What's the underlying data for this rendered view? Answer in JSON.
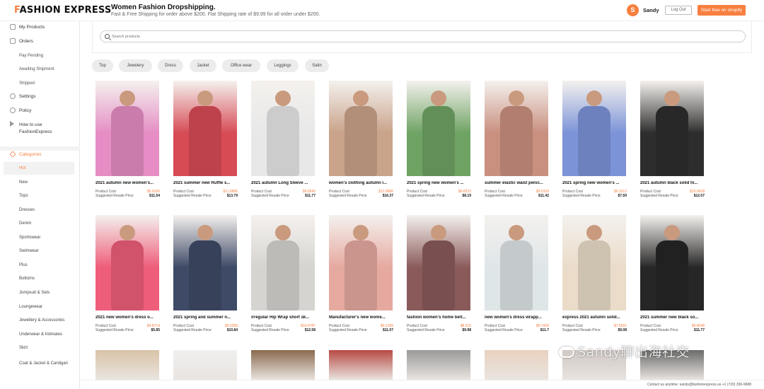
{
  "header": {
    "logo_first": "F",
    "logo_rest": "ASHION EXPRESS",
    "promo_title": "Women Fashion Dropshipping.",
    "promo_sub": "Fast & Free Shipping for order above $200. Flat Shipping rate of $9.99 for all order under $200.",
    "avatar_letter": "S",
    "username": "Sandy",
    "logout_label": "Log Out",
    "start_label": "Start free on shopify",
    "accent_color": "#f77f3f"
  },
  "sidebar": {
    "items": [
      {
        "label": "My Products",
        "icon": "products-icon"
      },
      {
        "label": "Orders",
        "icon": "orders-icon"
      },
      {
        "label": "Settings",
        "icon": "gear-icon"
      },
      {
        "label": "Policy",
        "icon": "shield-icon"
      },
      {
        "label": "How to use FashionExpress",
        "line1": "How to use",
        "line2": "FashionExpress",
        "icon": "play-icon"
      }
    ],
    "order_subs": [
      "Pay Pending",
      "Awaiting Shipment",
      "Shipped"
    ],
    "categories_label": "Categories",
    "categories": [
      "Hot",
      "New",
      "Tops",
      "Dresses",
      "Denim",
      "Sportswear",
      "Swimwear",
      "Plus",
      "Bottoms",
      "Jumpsuit & Sets",
      "Loungewear",
      "Jewellery & Accessories",
      "Underwear & Intimates",
      "Skirt",
      "Coat & Jacket & Cardigan"
    ]
  },
  "search": {
    "placeholder": "Search products"
  },
  "chips": [
    "Top",
    "Jewelery",
    "Dress",
    "Jacket",
    "Office wear",
    "Leggings",
    "Satin"
  ],
  "labels": {
    "product_cost": "Product Cost",
    "resale": "Suggested Resale Price"
  },
  "products": [
    {
      "name": "2021 autumn new women's...",
      "cost": "$5.6326",
      "resale": "$11.54",
      "color": "#e58dc4"
    },
    {
      "name": "2021 summer new Ruffle s...",
      "cost": "$11.6866",
      "resale": "$13.79",
      "color": "#d74b55"
    },
    {
      "name": "2021 autumn Long Sleeve ...",
      "cost": "$9.8540",
      "resale": "$11.77",
      "color": "#e8e8e8"
    },
    {
      "name": "women's clothing autumn l...",
      "cost": "$13.9686",
      "resale": "$16.37",
      "color": "#c9a38a"
    },
    {
      "name": "2021 spring new women's ...",
      "cost": "$6.8232",
      "resale": "$8.19",
      "color": "#6fa363"
    },
    {
      "name": "summer elastic waist penci...",
      "cost": "$9.5109",
      "resale": "$11.42",
      "color": "#c98f7f"
    },
    {
      "name": "2021 spring new women's ...",
      "cost": "$6.3212",
      "resale": "$7.59",
      "color": "#7c93d8"
    },
    {
      "name": "2021 autumn black solid hi...",
      "cost": "$10.0628",
      "resale": "$12.07",
      "color": "#2d2d2d"
    },
    {
      "name": "2021 new women's dress o...",
      "cost": "$4.8714",
      "resale": "$5.85",
      "color": "#ee5d7a"
    },
    {
      "name": "2021 spring and summer n...",
      "cost": "$9.0289",
      "resale": "$10.84",
      "color": "#3e4a66"
    },
    {
      "name": "irregular Hip Wrap short sk...",
      "cost": "$10.4787",
      "resale": "$12.58",
      "color": "#d6d4d0"
    },
    {
      "name": "Manufacturer's new wome...",
      "cost": "$9.2189",
      "resale": "$11.07",
      "color": "#e6a9a0"
    },
    {
      "name": "fashion women's home belt...",
      "cost": "$8.315",
      "resale": "$9.98",
      "color": "#8a5a5a"
    },
    {
      "name": "new women's dress wrapp...",
      "cost": "$9.7428",
      "resale": "$11.7",
      "color": "#dfe6e8"
    },
    {
      "name": "express 2021 autumn solid...",
      "cost": "$7.5591",
      "resale": "$9.08",
      "color": "#eadcc9"
    },
    {
      "name": "2021 summer new black so...",
      "cost": "$9.8048",
      "resale": "$11.77",
      "color": "#262626"
    }
  ],
  "partial_colors": [
    "#d9c3a8",
    "#f0f0f0",
    "#8b6a4f",
    "#b84a45",
    "#9a9a9a",
    "#e9d2c0",
    "#cfc8c4",
    "#6b6b6b"
  ],
  "footer": {
    "contact": "Contact us anytime: sandy@fashionexpress.us +1 (720) 336-9688"
  },
  "watermark": "Sandy聊出海社交"
}
